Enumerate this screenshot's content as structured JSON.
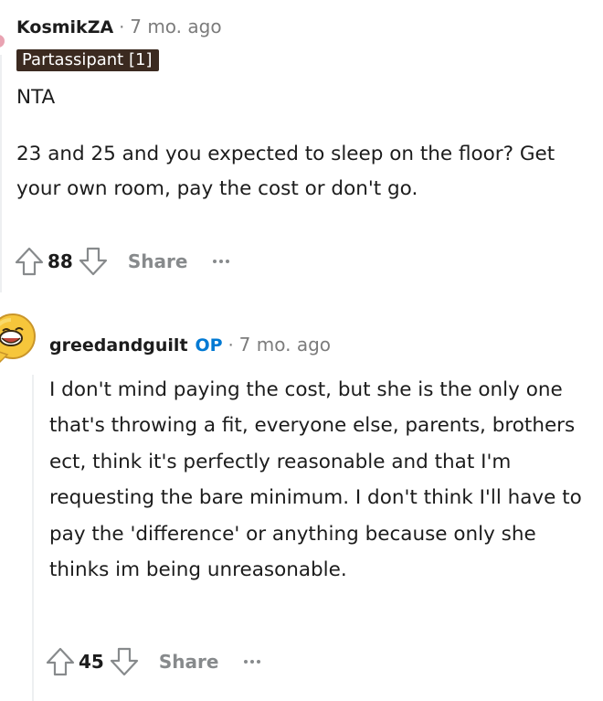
{
  "comments": [
    {
      "author": "KosmikZA",
      "separator": "·",
      "time": "7 mo. ago",
      "flair": "Partassipant [1]",
      "paragraphs": [
        "NTA",
        "23 and 25 and you expected to sleep on the floor? Get your own room, pay the cost or don't go."
      ],
      "votes": "88",
      "share_label": "Share",
      "upvote_icon": "upvote-arrow-icon",
      "downvote_icon": "downvote-arrow-icon",
      "more_icon": "more-options-icon"
    },
    {
      "author": "greedandguilt",
      "op_badge": "OP",
      "separator": "·",
      "time": "7 mo. ago",
      "paragraphs": [
        "I don't mind paying the cost, but she is the only one that's throwing a fit, everyone else, parents, brothers ect, think it's perfectly reasonable and that I'm requesting the bare minimum. I don't think I'll have to pay the 'difference' or anything because only she thinks im being unreasonable."
      ],
      "votes": "45",
      "share_label": "Share",
      "avatar_icon": "laughing-cartoon-avatar",
      "upvote_icon": "upvote-arrow-icon",
      "downvote_icon": "downvote-arrow-icon",
      "more_icon": "more-options-icon"
    }
  ],
  "colors": {
    "text": "#1c1c1c",
    "meta": "#7c7c7c",
    "flair_bg": "#3b2a20",
    "op": "#0079d3",
    "action_gray": "#878a8c"
  }
}
